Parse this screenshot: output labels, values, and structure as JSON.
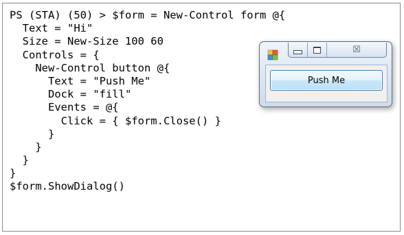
{
  "console": {
    "lines": [
      "PS (STA) (50) > $form = New-Control form @{",
      "  Text = \"Hi\"",
      "  Size = New-Size 100 60",
      "  Controls = {",
      "    New-Control button @{",
      "      Text = \"Push Me\"",
      "      Dock = \"fill\"",
      "      Events = @{",
      "        Click = { $form.Close() }",
      "      }",
      "    }",
      "  }",
      "}",
      "$form.ShowDialog()"
    ]
  },
  "form_window": {
    "icon": "winforms-app-icon",
    "caption_buttons": [
      "minimize-icon",
      "maximize-icon",
      "close-icon"
    ],
    "close_glyph": "☒",
    "button_label": "Push Me"
  },
  "colors": {
    "console_text": "#000000",
    "frame_border": "#8a8a8a",
    "button_border": "#3c7fb1",
    "window_border": "#5e6b7b"
  }
}
